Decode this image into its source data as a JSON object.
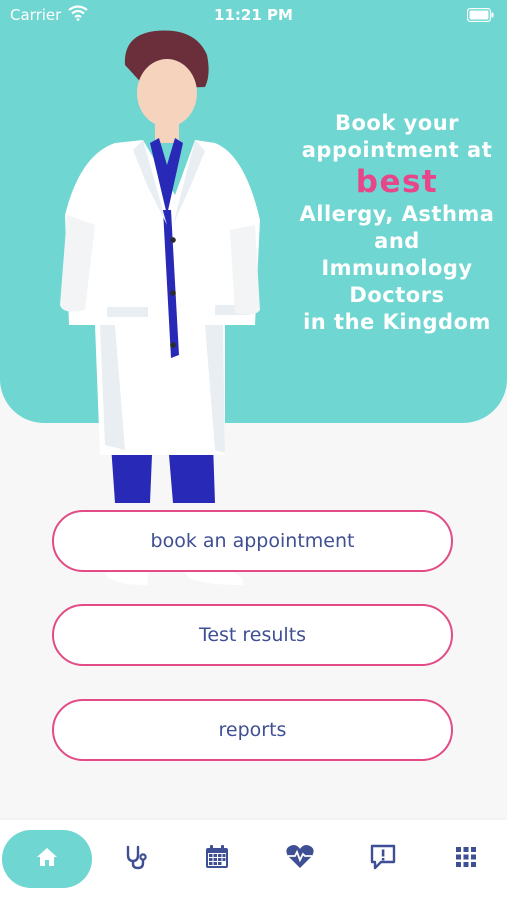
{
  "status_bar": {
    "carrier": "Carrier",
    "time": "11:21 PM"
  },
  "hero": {
    "line1": "Book your",
    "line2": "appointment at",
    "highlight": "best",
    "line3": "Allergy, Asthma",
    "line4": "and",
    "line5": "Immunology",
    "line6": "Doctors",
    "line7": "in the Kingdom"
  },
  "buttons": {
    "book": "book an appointment",
    "tests": "Test results",
    "reports": "reports"
  },
  "tabbar": {
    "items": [
      "home-icon",
      "stethoscope-icon",
      "calendar-icon",
      "heart-pulse-icon",
      "message-alert-icon",
      "grid-menu-icon"
    ],
    "active": "home-icon"
  },
  "colors": {
    "accent": "#6fd6d1",
    "highlight": "#e8468a",
    "button_text": "#3f4f93",
    "button_border": "#e24b86"
  }
}
